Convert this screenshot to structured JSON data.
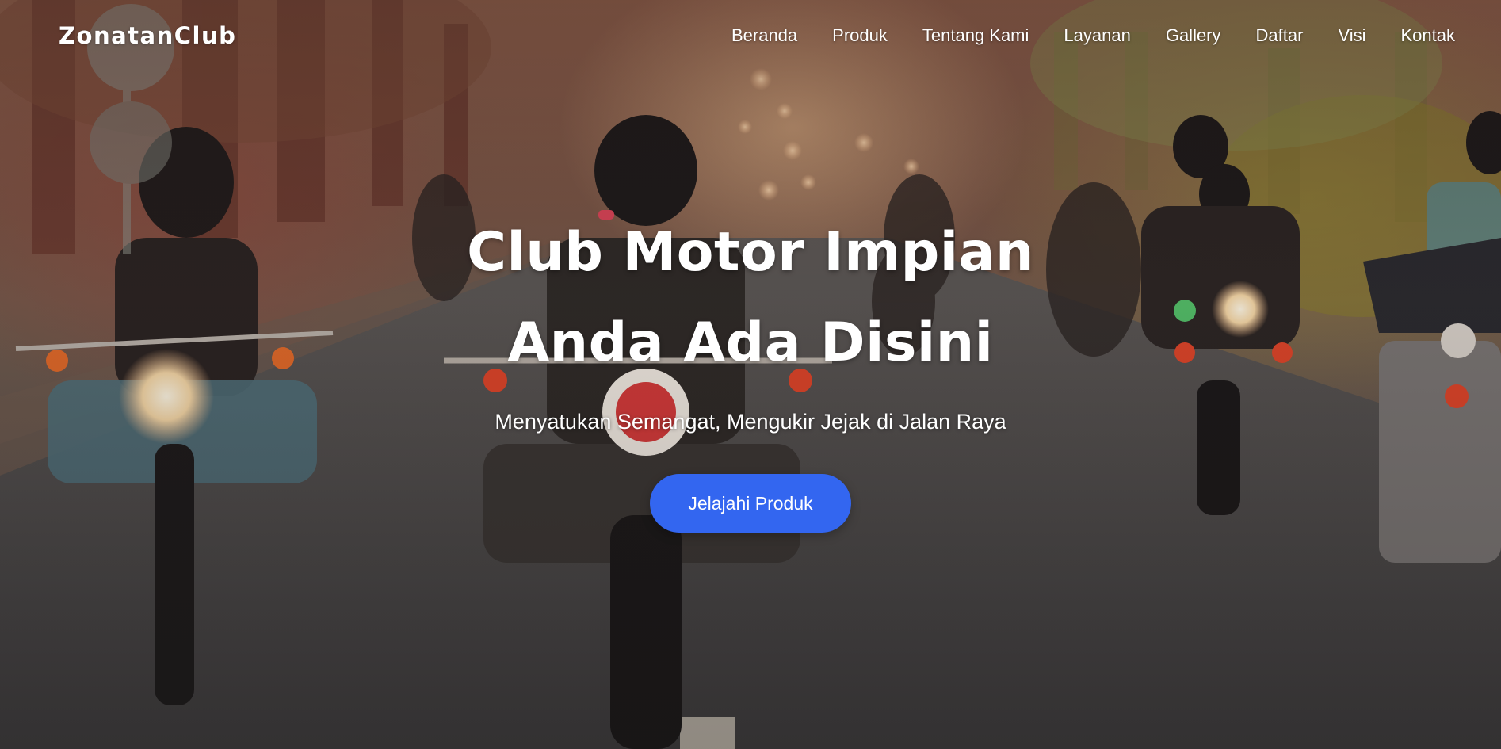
{
  "nav": {
    "brand": "ZonatanClub",
    "items": [
      {
        "label": "Beranda",
        "name": "nav-beranda"
      },
      {
        "label": "Produk",
        "name": "nav-produk"
      },
      {
        "label": "Tentang Kami",
        "name": "nav-tentang-kami"
      },
      {
        "label": "Layanan",
        "name": "nav-layanan"
      },
      {
        "label": "Gallery",
        "name": "nav-gallery"
      },
      {
        "label": "Daftar",
        "name": "nav-daftar"
      },
      {
        "label": "Visi",
        "name": "nav-visi"
      },
      {
        "label": "Kontak",
        "name": "nav-kontak"
      }
    ]
  },
  "hero": {
    "title_line1": "Club Motor Impian",
    "title_line2": "Anda Ada Disini",
    "subtitle": "Menyatukan Semangat, Mengukir Jejak di Jalan Raya",
    "cta_label": "Jelajahi Produk"
  },
  "colors": {
    "cta_background": "#3366f0",
    "text": "#ffffff"
  }
}
